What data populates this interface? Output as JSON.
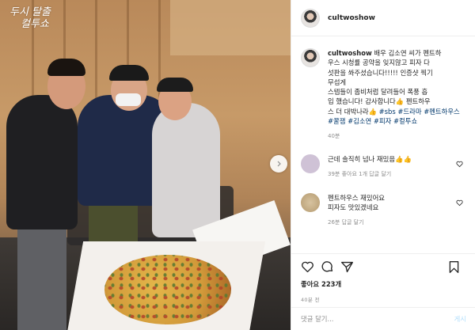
{
  "photo": {
    "logo_lines": [
      "두시 탈출",
      "컬투쇼"
    ],
    "next_arrow_icon": "chevron-right-icon"
  },
  "header": {
    "username": "cultwoshow",
    "avatar_icon": "profile-avatar"
  },
  "caption": {
    "username": "cultwoshow",
    "text_lines": [
      "배우 김소연 씨가 펜트하",
      "우스 시청률 공약을 잊지않고 피자 다",
      "섯판을 쏴주셨습니다!!!!! 인증샷 찍기",
      "무섭게",
      "스텝들이 좀비처럼 달려들어 폭풍 흡",
      "입 했습니다! 감사합니다👍 펜트하우",
      "스 더 대박나라👍"
    ],
    "hashtags": [
      "#sbs",
      "#드라마",
      "#펜트하우스",
      "#꿀잼",
      "#김소연",
      "#피자",
      "#컬투쇼"
    ],
    "time": "40분"
  },
  "comments": [
    {
      "text": "근데 솔직히 넘나 재밌음👍👍",
      "meta": "39분  좋아요 1개  답글 달기",
      "avatar_color": "#cfc2d6"
    },
    {
      "text_lines": [
        "펜트하우스 재밌어요",
        "피자도 맛있겠네요"
      ],
      "meta": "26분  답글 달기",
      "avatar_color": "#cbb594"
    }
  ],
  "actions": {
    "icons": [
      "heart-icon",
      "comment-icon",
      "share-icon",
      "bookmark-icon"
    ],
    "likes": "좋아요 223개",
    "time": "40분 전"
  },
  "comment_box": {
    "placeholder": "댓글 달기...",
    "post_label": "게시"
  },
  "colors": {
    "hashtag": "#00376b",
    "muted": "#8e8e8e",
    "post_button": "#b2dffc"
  }
}
